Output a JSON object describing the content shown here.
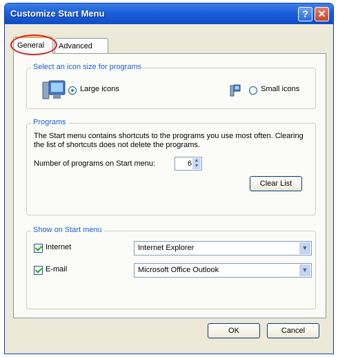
{
  "window": {
    "title": "Customize Start Menu",
    "help_label": "?",
    "close_label": "✕"
  },
  "tabs": [
    {
      "label": "General",
      "active": true
    },
    {
      "label": "Advanced",
      "active": false
    }
  ],
  "icon_size": {
    "legend": "Select an icon size for programs",
    "large_label": "Large icons",
    "small_label": "Small icons",
    "selected": "large"
  },
  "programs": {
    "legend": "Programs",
    "description": "The Start menu contains shortcuts to the programs you use most often. Clearing the list of shortcuts does not delete the programs.",
    "number_label": "Number of programs on Start menu:",
    "number_value": "6",
    "clear_label": "Clear List"
  },
  "show_on_start": {
    "legend": "Show on Start menu",
    "internet": {
      "label": "Internet",
      "checked": true,
      "value": "Internet Explorer"
    },
    "email": {
      "label": "E-mail",
      "checked": true,
      "value": "Microsoft Office Outlook"
    }
  },
  "footer": {
    "ok_label": "OK",
    "cancel_label": "Cancel"
  },
  "colors": {
    "title_bar": "#1b5fd8",
    "legend_text": "#1f5bd6",
    "highlight_ring": "#d82020"
  },
  "icons": [
    "computer-monitor-icon",
    "small-computer-icon",
    "help-icon",
    "close-icon",
    "spinner-arrows-icon",
    "dropdown-arrow-icon"
  ]
}
